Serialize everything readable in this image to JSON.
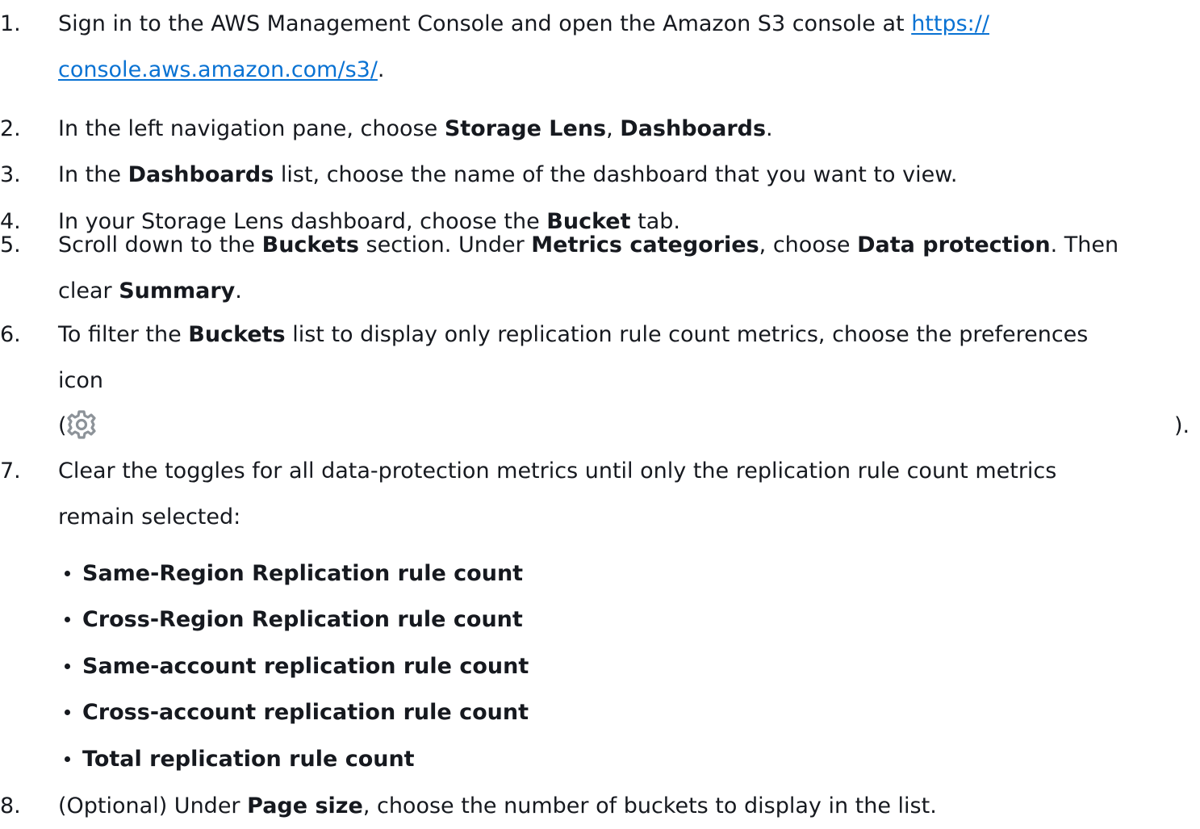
{
  "steps": [
    {
      "num": "1.",
      "parts": [
        {
          "t": "Sign in to the AWS Management Console and open the Amazon S3 console at "
        },
        {
          "t": "https://",
          "link": true
        },
        {
          "br": true
        },
        {
          "t": "console.aws.amazon.com/s3/",
          "link": true
        },
        {
          "t": "."
        }
      ]
    },
    {
      "num": "2.",
      "parts": [
        {
          "t": "In the left navigation pane, choose "
        },
        {
          "t": "Storage Lens",
          "b": true
        },
        {
          "t": ", "
        },
        {
          "t": "Dashboards",
          "b": true
        },
        {
          "t": "."
        }
      ]
    },
    {
      "num": "3.",
      "parts": [
        {
          "t": "In the "
        },
        {
          "t": "Dashboards",
          "b": true
        },
        {
          "t": " list, choose the name of the dashboard that you want to view."
        }
      ]
    },
    {
      "num": "4.",
      "parts": [
        {
          "t": "In your Storage Lens dashboard, choose the "
        },
        {
          "t": "Bucket",
          "b": true
        },
        {
          "t": " tab."
        }
      ]
    },
    {
      "num": "5.",
      "parts": [
        {
          "t": "Scroll down to the "
        },
        {
          "t": "Buckets",
          "b": true
        },
        {
          "t": " section. Under "
        },
        {
          "t": "Metrics categories",
          "b": true
        },
        {
          "t": ", choose "
        },
        {
          "t": "Data protection",
          "b": true
        },
        {
          "t": ". Then"
        },
        {
          "br": true
        },
        {
          "t": "clear "
        },
        {
          "t": "Summary",
          "b": true
        },
        {
          "t": "."
        }
      ]
    },
    {
      "num": "6.",
      "parts": [
        {
          "t": "To filter the "
        },
        {
          "t": "Buckets",
          "b": true
        },
        {
          "t": " list to display only replication rule count metrics, choose the preferences"
        },
        {
          "br": true
        },
        {
          "t": "icon"
        }
      ]
    },
    {
      "num": "7.",
      "parts": [
        {
          "t": "Clear the toggles for all data-protection metrics until only the replication rule count metrics"
        },
        {
          "br": true
        },
        {
          "t": "remain selected:"
        }
      ]
    },
    {
      "num": "8.",
      "parts": [
        {
          "t": "(Optional) Under "
        },
        {
          "t": "Page size",
          "b": true
        },
        {
          "t": ", choose the number of buckets to display in the list."
        }
      ]
    }
  ],
  "gear_line": {
    "open": "(",
    "close": ").",
    "icon": "gear-icon"
  },
  "metrics": [
    "Same-Region Replication rule count",
    "Cross-Region Replication rule count",
    "Same-account replication rule count",
    "Cross-account replication rule count",
    "Total replication rule count"
  ],
  "colors": {
    "text": "#16191f",
    "link": "#0972d3",
    "icon": "#8d9399"
  }
}
